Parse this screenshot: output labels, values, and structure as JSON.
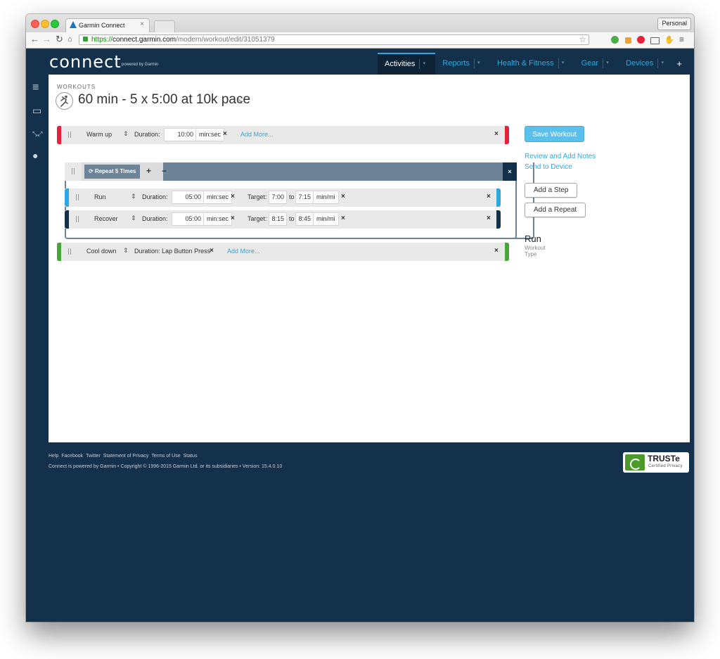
{
  "browser": {
    "tab_title": "Garmin Connect",
    "tab_close": "×",
    "profile": "Personal",
    "url_proto": "https://",
    "url_host": "connect.garmin.com",
    "url_path": "/modern/workout/edit/31051379"
  },
  "header": {
    "logo": "connect",
    "powered": "powered by Garmin",
    "nav": [
      {
        "label": "Activities",
        "active": true
      },
      {
        "label": "Reports",
        "active": false
      },
      {
        "label": "Health & Fitness",
        "active": false
      },
      {
        "label": "Gear",
        "active": false
      },
      {
        "label": "Devices",
        "active": false
      }
    ],
    "plus": "+"
  },
  "page": {
    "breadcrumb": "WORKOUTS",
    "title": "60 min - 5 x 5:00 at 10k pace"
  },
  "steps": {
    "warmup": {
      "name": "Warm up",
      "duration_label": "Duration:",
      "duration": "10:00",
      "unit": "min:sec",
      "add_more": "Add More...",
      "color": "#e8203a"
    },
    "repeat": {
      "label": "Repeat 5 Times",
      "plus": "+",
      "minus": "−"
    },
    "run": {
      "name": "Run",
      "duration_label": "Duration:",
      "duration": "05:00",
      "unit": "min:sec",
      "target_label": "Target:",
      "target_from": "7:00",
      "to": "to",
      "target_to": "7:15",
      "target_unit": "min/mi",
      "color": "#2da8e0"
    },
    "recover": {
      "name": "Recover",
      "duration_label": "Duration:",
      "duration": "05:00",
      "unit": "min:sec",
      "target_label": "Target:",
      "target_from": "8:15",
      "to": "to",
      "target_to": "8:45",
      "target_unit": "min/mi",
      "color": "#14314b"
    },
    "cooldown": {
      "name": "Cool down",
      "duration_label": "Duration:",
      "duration": "Lap Button Press",
      "add_more": "Add More...",
      "color": "#45a735"
    }
  },
  "panel": {
    "save": "Save Workout",
    "review": "Review and Add Notes",
    "send": "Send to Device",
    "add_step": "Add a Step",
    "add_repeat": "Add a Repeat",
    "workout_type_value": "Run",
    "workout_type_label": "Workout Type"
  },
  "footer": {
    "links": [
      "Help",
      "Facebook",
      "Twitter",
      "Statement of Privacy",
      "Terms of Use",
      "Status"
    ],
    "copyright": "Connect is powered by Garmin • Copyright © 1996-2015 Garmin Ltd. or its subsidiaries • Version: 15.4.0.10",
    "truste_name": "TRUSTe",
    "truste_sub": "Certified Privacy"
  },
  "icons": {
    "x": "×",
    "updown": "⇕",
    "pencil": "✎",
    "repeat": "⟳"
  }
}
